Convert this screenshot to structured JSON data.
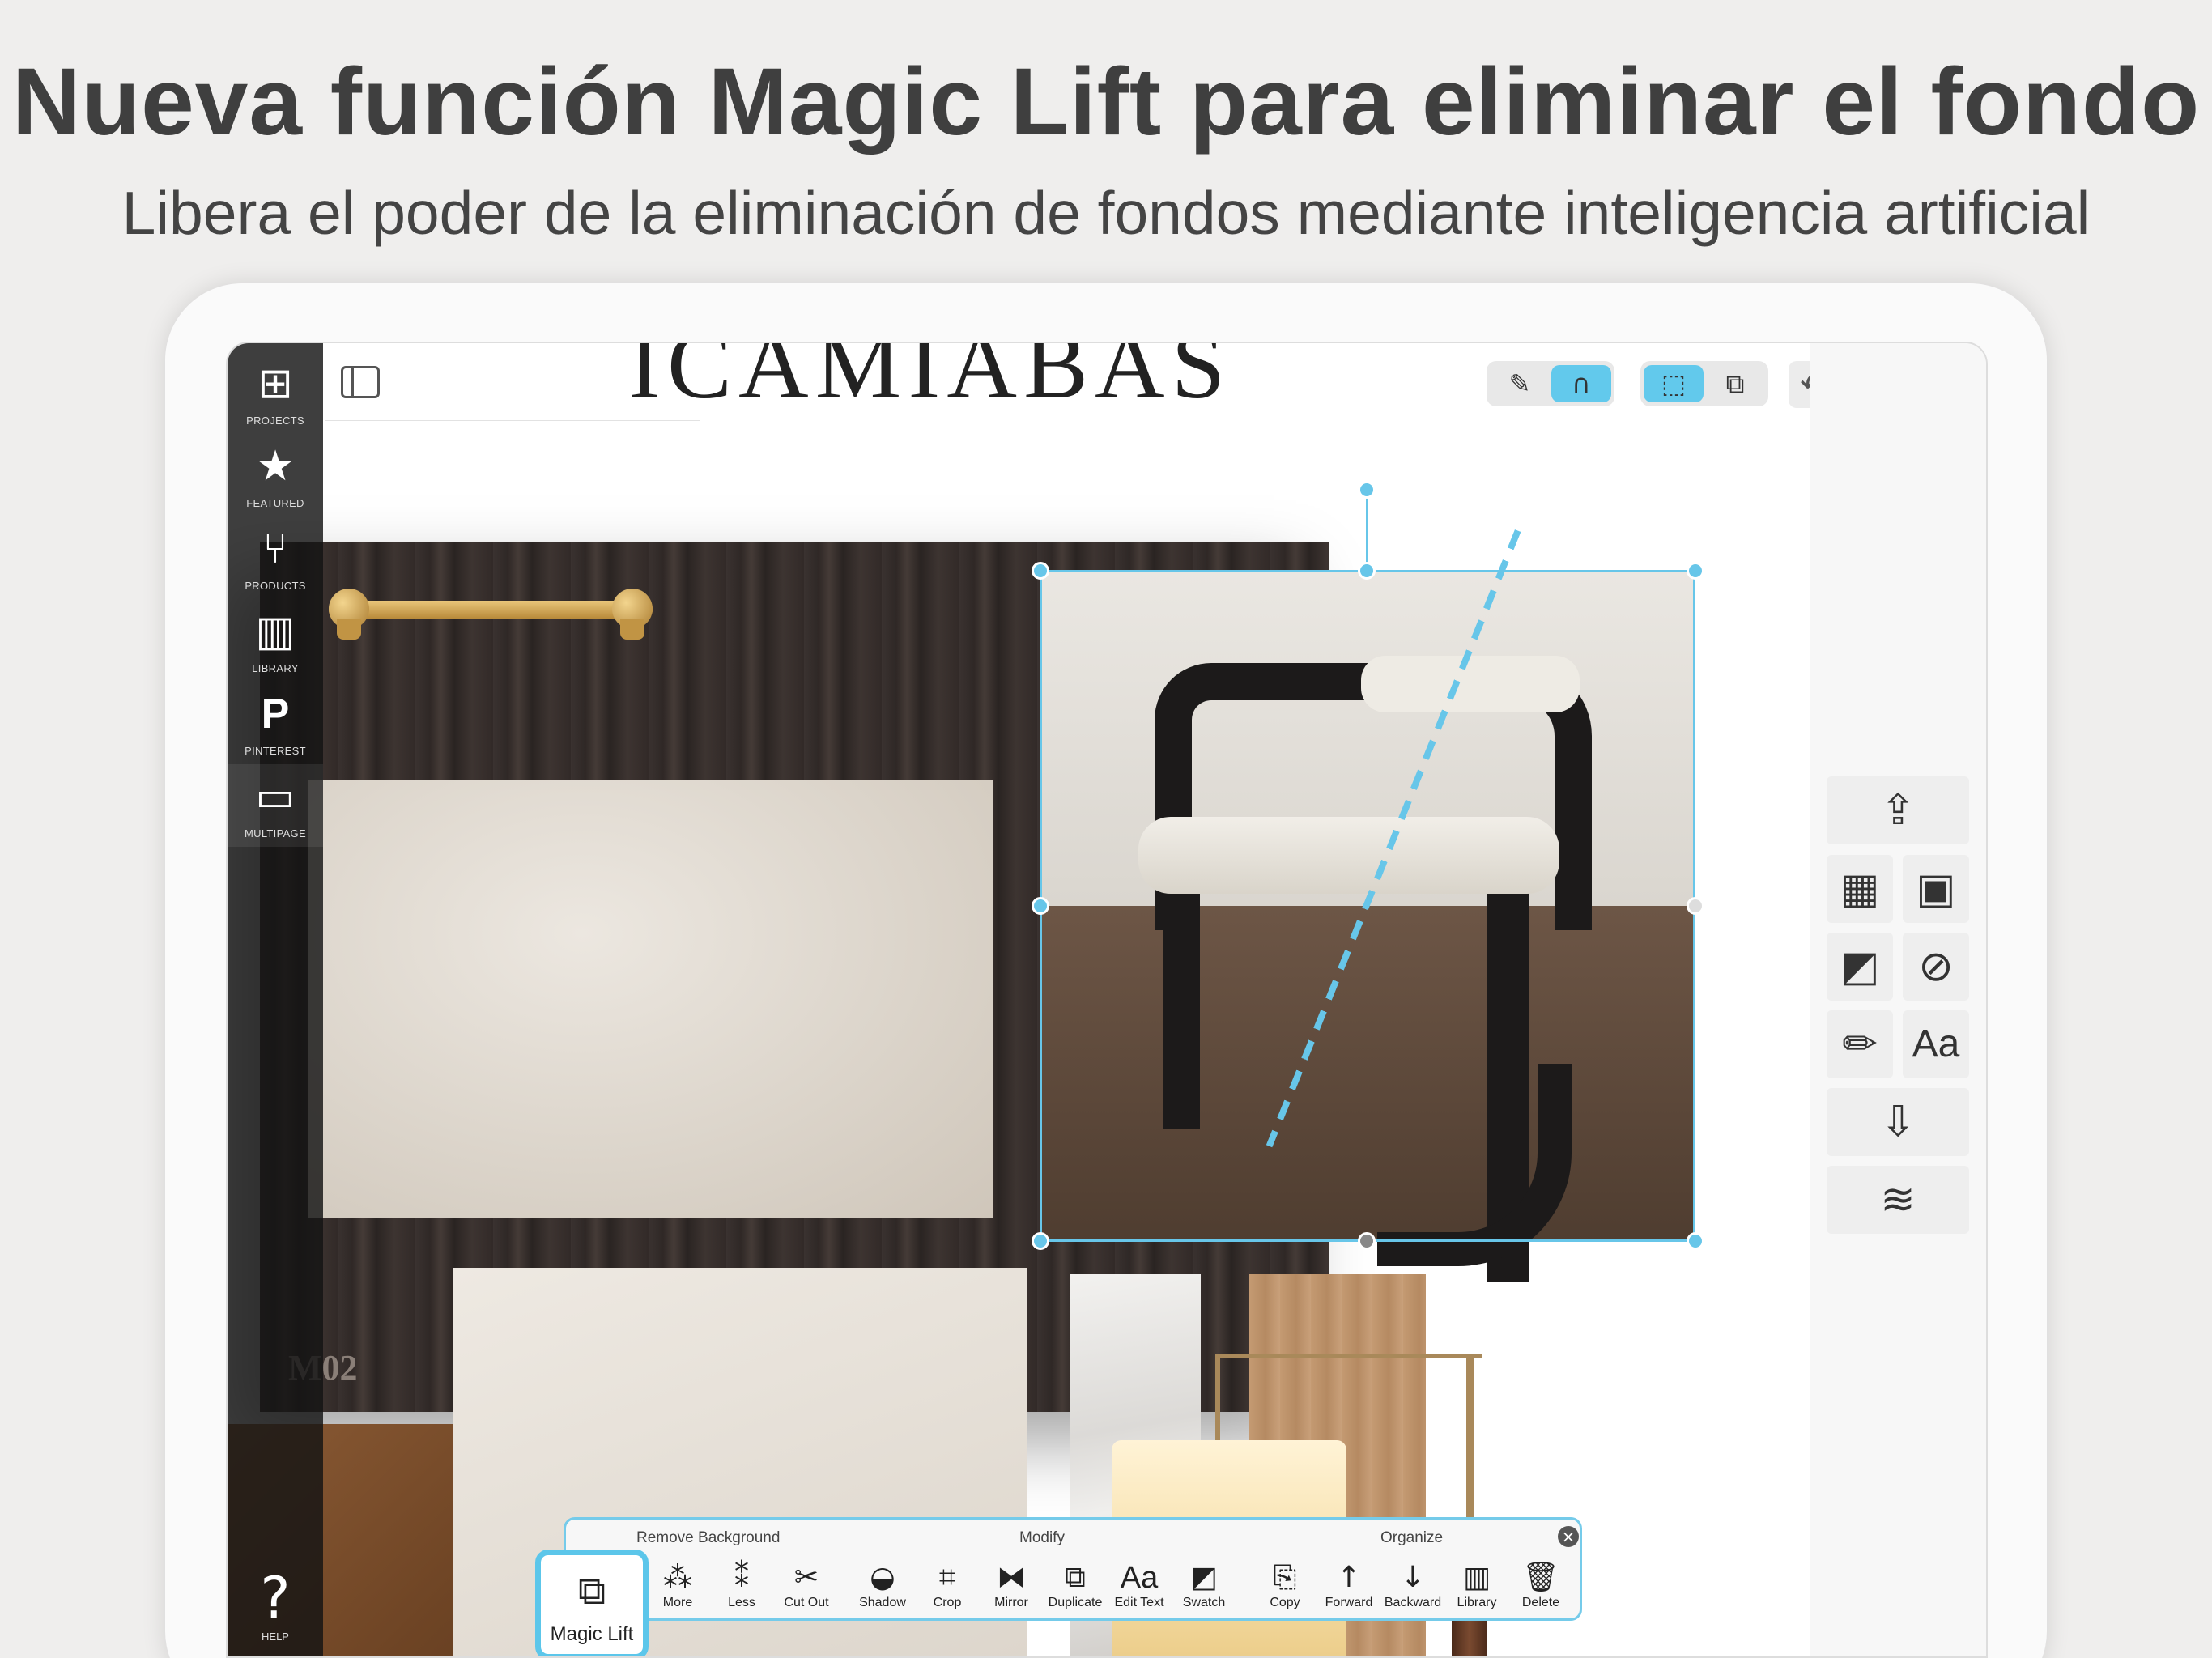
{
  "headline": "Nueva función Magic Lift para eliminar el fondo",
  "subheadline": "Libera el poder de la eliminación de fondos mediante inteligencia artificial",
  "board": {
    "title": "ICAMIABAS",
    "material_label": "M02"
  },
  "sidebar": {
    "items": [
      {
        "label": "PROJECTS",
        "icon": "grid-icon"
      },
      {
        "label": "FEATURED",
        "icon": "star-icon"
      },
      {
        "label": "PRODUCTS",
        "icon": "chair-icon"
      },
      {
        "label": "LIBRARY",
        "icon": "books-icon"
      },
      {
        "label": "PINTEREST",
        "icon": "pinterest-icon"
      },
      {
        "label": "MULTIPAGE",
        "icon": "pages-icon"
      }
    ],
    "help_label": "HELP"
  },
  "toolbar": {
    "sections": {
      "remove_background": "Remove Background",
      "modify": "Modify",
      "organize": "Organize"
    },
    "magic_lift_label": "Magic Lift",
    "items": [
      {
        "label": "More",
        "icon": "wand-plus-icon"
      },
      {
        "label": "Less",
        "icon": "wand-minus-icon"
      },
      {
        "label": "Cut Out",
        "icon": "scissors-icon"
      },
      {
        "label": "Shadow",
        "icon": "shadow-icon"
      },
      {
        "label": "Crop",
        "icon": "crop-icon"
      },
      {
        "label": "Mirror",
        "icon": "mirror-icon"
      },
      {
        "label": "Duplicate",
        "icon": "duplicate-icon"
      },
      {
        "label": "Edit Text",
        "icon": "text-icon",
        "glyph": "Aa"
      },
      {
        "label": "Swatch",
        "icon": "swatch-icon"
      },
      {
        "label": "Copy",
        "icon": "copy-icon"
      },
      {
        "label": "Forward",
        "icon": "arrow-up-icon"
      },
      {
        "label": "Backward",
        "icon": "arrow-down-icon"
      },
      {
        "label": "Library",
        "icon": "library-add-icon"
      },
      {
        "label": "Delete",
        "icon": "trash-icon"
      }
    ]
  },
  "right_tools": {
    "text_glyph": "Aa"
  },
  "colors": {
    "accent": "#62c9ec",
    "headline": "#3f3f3f",
    "sidebar": "#141414"
  }
}
